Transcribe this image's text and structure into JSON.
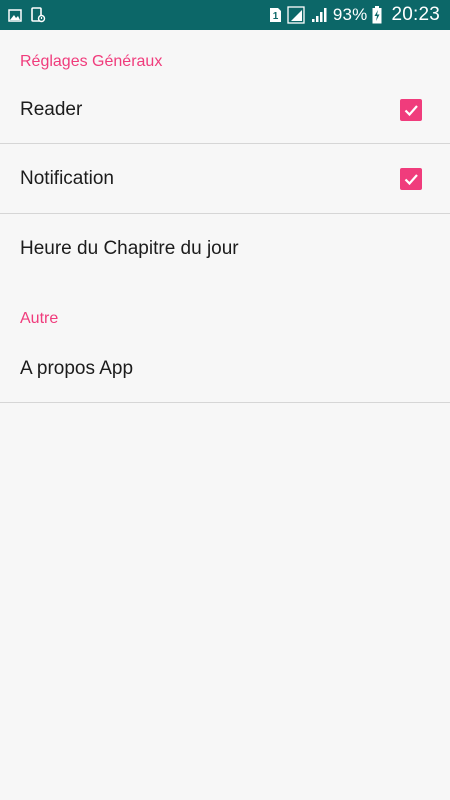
{
  "status_bar": {
    "sim_badge": "1",
    "battery": "93%",
    "time": "20:23",
    "color": "#0c6768"
  },
  "settings": {
    "accent_color": "#f03c7c",
    "sections": [
      {
        "header": "Réglages Généraux",
        "items": [
          {
            "label": "Reader",
            "checked": true
          },
          {
            "label": "Notification",
            "checked": true
          },
          {
            "label": "Heure du Chapitre du jour"
          }
        ]
      },
      {
        "header": "Autre",
        "items": [
          {
            "label": "A propos App"
          }
        ]
      }
    ]
  }
}
